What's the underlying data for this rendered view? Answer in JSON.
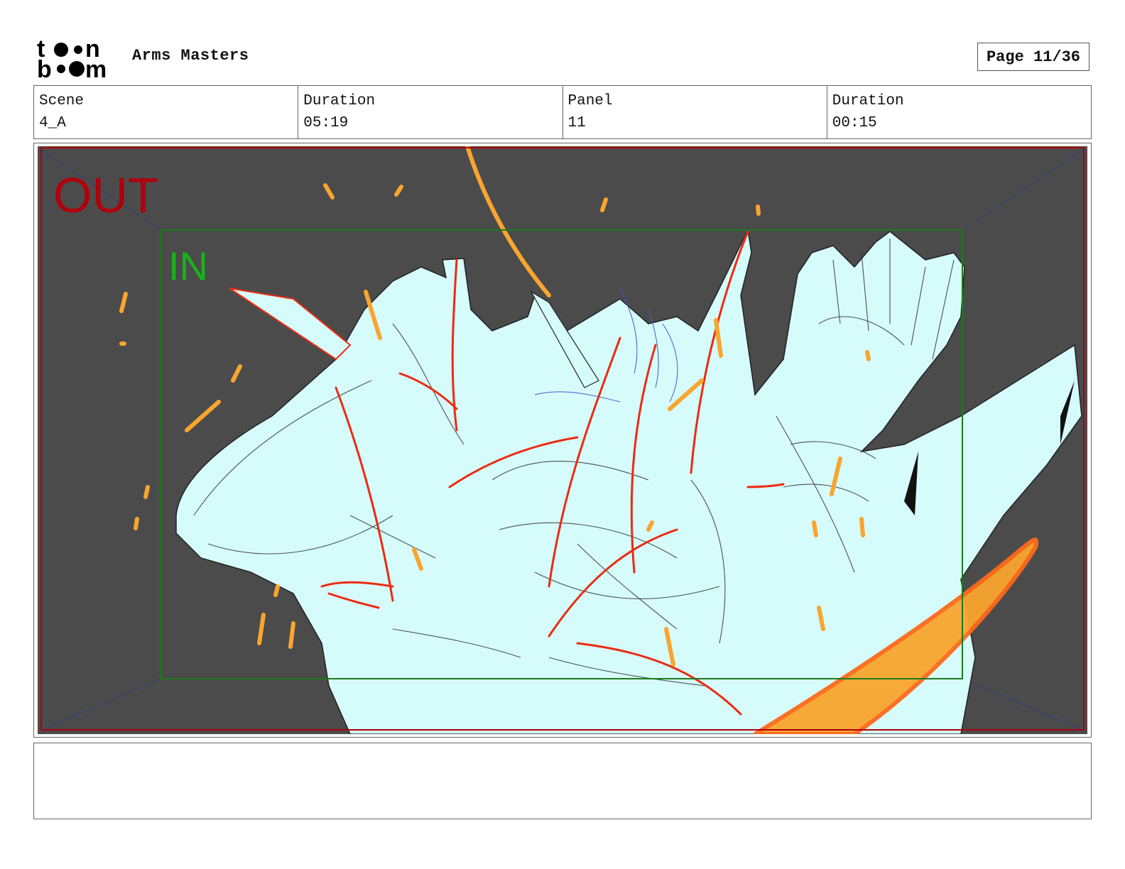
{
  "header": {
    "logo_text": "toon boom",
    "project_title": "Arms Masters",
    "page_label": "Page 11/36"
  },
  "info": [
    {
      "label": "Scene",
      "value": "4_A"
    },
    {
      "label": "Duration",
      "value": "05:19"
    },
    {
      "label": "Panel",
      "value": "11"
    },
    {
      "label": "Duration",
      "value": "00:15"
    }
  ],
  "panel": {
    "out_label": "OUT",
    "in_label": "IN",
    "colors": {
      "background": "#4b4b4b",
      "out_frame": "#b0000c",
      "in_frame": "#1d7a1d",
      "body_fill": "#d6fbfb",
      "accent_orange": "#f9a52e",
      "accent_red": "#ee2a10"
    }
  },
  "notes": {
    "text": ""
  }
}
